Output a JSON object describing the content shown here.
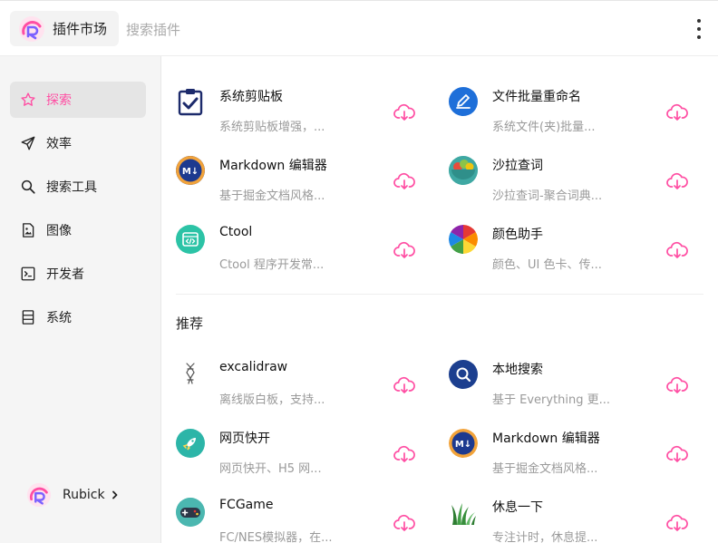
{
  "app": {
    "title": "插件市场",
    "search_placeholder": "搜索插件"
  },
  "colors": {
    "accent": "#ff4ea3",
    "sidebar_bg": "#f5f5f5"
  },
  "sidebar": {
    "items": [
      {
        "label": "探索",
        "icon": "star-icon",
        "active": true
      },
      {
        "label": "效率",
        "icon": "send-icon"
      },
      {
        "label": "搜索工具",
        "icon": "search-icon"
      },
      {
        "label": "图像",
        "icon": "image-file-icon"
      },
      {
        "label": "开发者",
        "icon": "terminal-icon"
      },
      {
        "label": "系统",
        "icon": "server-icon"
      }
    ],
    "user": {
      "name": "Rubick"
    }
  },
  "featured": [
    {
      "name": "系统剪贴板",
      "desc": "系统剪贴板增强，...",
      "icon": "clipboard-check-icon"
    },
    {
      "name": "文件批量重命名",
      "desc": "系统文件(夹)批量...",
      "icon": "pencil-icon"
    },
    {
      "name": "Markdown 编辑器",
      "desc": "基于掘金文档风格...",
      "icon": "markdown-icon"
    },
    {
      "name": "沙拉查词",
      "desc": "沙拉查词-聚合词典...",
      "icon": "salad-bowl-icon"
    },
    {
      "name": "Ctool",
      "desc": "Ctool 程序开发常...",
      "icon": "code-window-icon"
    },
    {
      "name": "颜色助手",
      "desc": "颜色、UI 色卡、传...",
      "icon": "color-wheel-icon"
    }
  ],
  "recommend": {
    "title": "推荐",
    "items": [
      {
        "name": "excalidraw",
        "desc": "离线版白板，支持...",
        "icon": "excalidraw-icon"
      },
      {
        "name": "本地搜索",
        "desc": "基于 Everything 更...",
        "icon": "magnifier-icon"
      },
      {
        "name": "网页快开",
        "desc": "网页快开、H5 网...",
        "icon": "rocket-icon"
      },
      {
        "name": "Markdown 编辑器",
        "desc": "基于掘金文档风格...",
        "icon": "markdown-icon"
      },
      {
        "name": "FCGame",
        "desc": "FC/NES模拟器，在...",
        "icon": "gamepad-icon"
      },
      {
        "name": "休息一下",
        "desc": "专注计时，休息提...",
        "icon": "grass-icon"
      }
    ]
  }
}
